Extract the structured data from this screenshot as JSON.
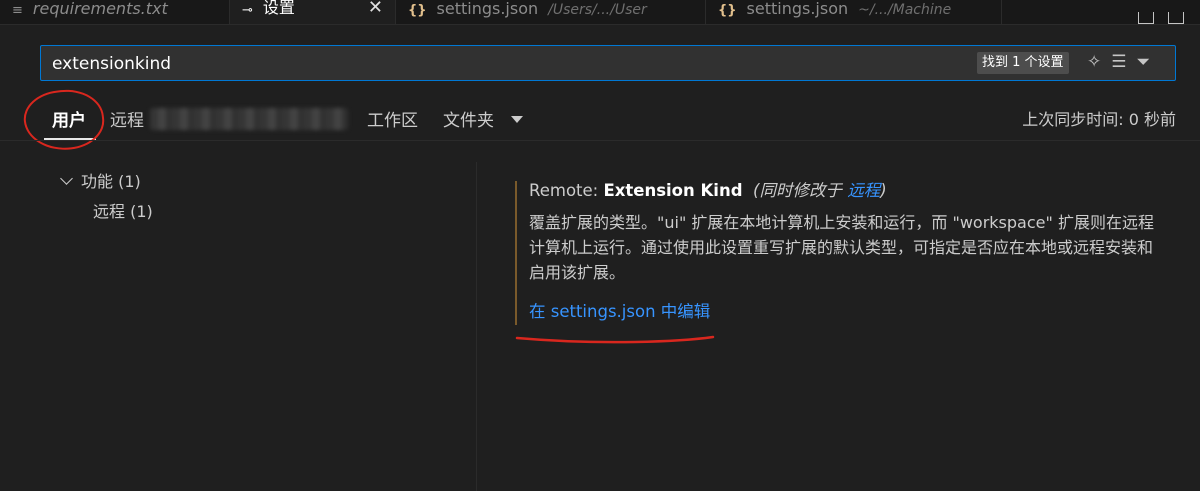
{
  "tabs": [
    {
      "icon": "≡",
      "label": "requirements.txt",
      "sub": ""
    },
    {
      "icon": "⊸",
      "label": "设置",
      "sub": "",
      "close": "✕"
    },
    {
      "icon": "{}",
      "label": "settings.json",
      "sub": "/Users/.../User"
    },
    {
      "icon": "{}",
      "label": "settings.json",
      "sub": "~/.../Machine"
    }
  ],
  "search": {
    "value": "extensionkind",
    "result_count": "找到 1 个设置"
  },
  "scopes": {
    "user": "用户",
    "remote": "远程",
    "workspace": "工作区",
    "folder": "文件夹"
  },
  "sync_status": "上次同步时间: 0 秒前",
  "toc": {
    "features": "功能 (1)",
    "remote": "远程 (1)"
  },
  "setting": {
    "category": "Remote: ",
    "name": "Extension Kind",
    "modified_prefix": "(同时修改于 ",
    "modified_link": "远程",
    "modified_suffix": ")",
    "description": "覆盖扩展的类型。\"ui\" 扩展在本地计算机上安装和运行，而 \"workspace\" 扩展则在远程计算机上运行。通过使用此设置重写扩展的默认类型，可指定是否应在本地或远程安装和启用该扩展。",
    "edit_link": "在 settings.json 中编辑"
  },
  "colors": {
    "accent_blue": "#0078d4",
    "link": "#3794ff",
    "annotation_red": "#d9271e"
  }
}
